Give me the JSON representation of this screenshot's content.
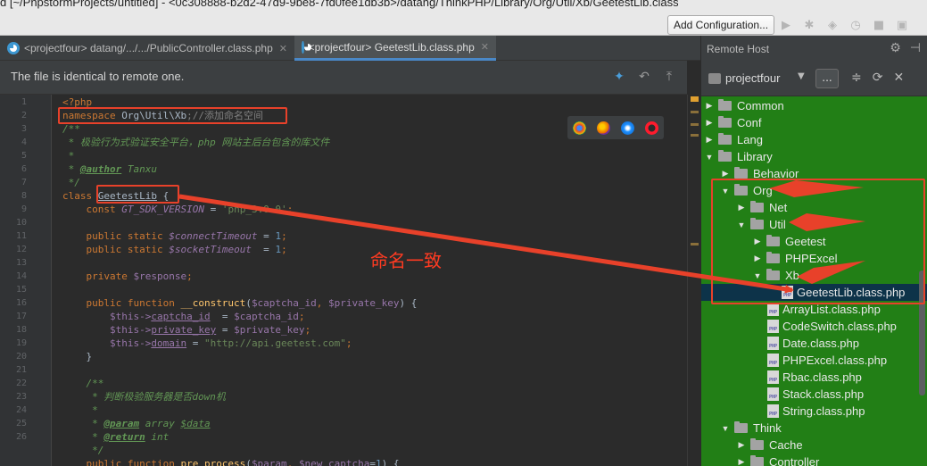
{
  "window": {
    "title": "d [~/PhpstormProjects/untitled] - <0c308888-b2d2-47d9-9be8-7fd0fee1db3b>/datang/ThinkPHP/Library/Org/Util/Xb/GeetestLib.class.php"
  },
  "toolbar": {
    "add_configuration": "Add Configuration...",
    "icons": [
      "run-icon",
      "debug-icon",
      "coverage-icon",
      "profile-icon",
      "stop-icon",
      "layout-icon"
    ]
  },
  "tabs": [
    {
      "label": "<projectfour> datang/.../.../PublicController.class.php",
      "active": false
    },
    {
      "label": "<projectfour> GeetestLib.class.php",
      "active": true
    }
  ],
  "banner": {
    "text": "The file is identical to remote one."
  },
  "editor": {
    "line_numbers": [
      "1",
      "2",
      "3",
      "4",
      "5",
      "6",
      "7",
      "8",
      "9",
      "10",
      "11",
      "12",
      "13",
      "14",
      "15",
      "16",
      "17",
      "18",
      "19",
      "20",
      "21",
      "22",
      "23",
      "24",
      "25",
      "26"
    ],
    "lines": {
      "l1": "<?php",
      "l2_kw": "namespace ",
      "l2_ns": "Org\\Util\\Xb",
      "l2_cmt": ";//添加命名空间",
      "l3": "/**",
      "l4": " * 极验行为式验证安全平台，php 网站主后台包含的库文件",
      "l5": " *",
      "l6_prefix": " * ",
      "l6_tag": "@author",
      "l6_val": " Tanxu",
      "l7": " */",
      "l8_kw": "class ",
      "l8_name": "GeetestLib",
      "l8_brace": " {",
      "l9_kw": "    const ",
      "l9_const": "GT_SDK_VERSION",
      "l9_eq": " = ",
      "l9_str": "'php_3.0.0'",
      "l9_end": ";",
      "l11_kw": "    public static ",
      "l11_var": "$connectTimeout",
      "l11_eq": " = ",
      "l11_num": "1",
      "l11_end": ";",
      "l12_kw": "    public static ",
      "l12_var": "$socketTimeout",
      "l12_eq": "  = ",
      "l12_num": "1",
      "l12_end": ";",
      "l14_kw": "    private ",
      "l14_var": "$response",
      "l14_end": ";",
      "l16_kw": "    public function ",
      "l16_fn": "__construct",
      "l16_open": "(",
      "l16_a1": "$captcha_id",
      "l16_sep": ", ",
      "l16_a2": "$private_key",
      "l16_close": ") {",
      "l17_this": "        $this->",
      "l17_prop": "captcha_id",
      "l17_eq": "  = ",
      "l17_var": "$captcha_id",
      "l17_end": ";",
      "l18_this": "        $this->",
      "l18_prop": "private_key",
      "l18_eq": " = ",
      "l18_var": "$private_key",
      "l18_end": ";",
      "l19_this": "        $this->",
      "l19_prop": "domain",
      "l19_eq": " = ",
      "l19_str": "\"http://api.geetest.com\"",
      "l19_end": ";",
      "l20": "    }",
      "l22": "    /**",
      "l23": "     * 判断极验服务器是否down机",
      "l24": "     *",
      "l25_prefix": "     * ",
      "l25_tag": "@param",
      "l25_type": " array ",
      "l25_var": "$data",
      "l26_prefix": "     * ",
      "l26_tag": "@return",
      "l26_val": " int",
      "l27": "     */",
      "l28_kw": "    public function ",
      "l28_fn": "pre_process",
      "l28_open": "(",
      "l28_a1": "$param",
      "l28_sep": ", ",
      "l28_a2": "$new_captcha",
      "l28_eq": "=",
      "l28_num": "1",
      "l28_close": ") {"
    }
  },
  "remote_panel": {
    "title": "Remote Host",
    "server": "projectfour",
    "dots_label": "...",
    "tree": [
      {
        "label": "Common",
        "depth": 0,
        "type": "folder",
        "expanded": false
      },
      {
        "label": "Conf",
        "depth": 0,
        "type": "folder",
        "expanded": false
      },
      {
        "label": "Lang",
        "depth": 0,
        "type": "folder",
        "expanded": false
      },
      {
        "label": "Library",
        "depth": 0,
        "type": "folder",
        "expanded": true
      },
      {
        "label": "Behavior",
        "depth": 1,
        "type": "folder",
        "expanded": false
      },
      {
        "label": "Org",
        "depth": 1,
        "type": "folder",
        "expanded": true
      },
      {
        "label": "Net",
        "depth": 2,
        "type": "folder",
        "expanded": false
      },
      {
        "label": "Util",
        "depth": 2,
        "type": "folder",
        "expanded": true
      },
      {
        "label": "Geetest",
        "depth": 3,
        "type": "folder",
        "expanded": false
      },
      {
        "label": "PHPExcel",
        "depth": 3,
        "type": "folder",
        "expanded": false
      },
      {
        "label": "Xb",
        "depth": 3,
        "type": "folder",
        "expanded": true
      },
      {
        "label": "GeetestLib.class.php",
        "depth": 4,
        "type": "file",
        "selected": true
      },
      {
        "label": "ArrayList.class.php",
        "depth": 3,
        "type": "file"
      },
      {
        "label": "CodeSwitch.class.php",
        "depth": 3,
        "type": "file"
      },
      {
        "label": "Date.class.php",
        "depth": 3,
        "type": "file"
      },
      {
        "label": "PHPExcel.class.php",
        "depth": 3,
        "type": "file"
      },
      {
        "label": "Rbac.class.php",
        "depth": 3,
        "type": "file"
      },
      {
        "label": "Stack.class.php",
        "depth": 3,
        "type": "file"
      },
      {
        "label": "String.class.php",
        "depth": 3,
        "type": "file"
      },
      {
        "label": "Think",
        "depth": 1,
        "type": "folder",
        "expanded": true
      },
      {
        "label": "Cache",
        "depth": 2,
        "type": "folder",
        "expanded": false
      },
      {
        "label": "Controller",
        "depth": 2,
        "type": "folder",
        "expanded": false
      }
    ]
  },
  "annotation": {
    "label": "命名一致",
    "color": "#e8412a"
  },
  "colors": {
    "editor_bg": "#2b2b2b",
    "tree_bg": "#227f16",
    "accent": "#4a88c7"
  }
}
